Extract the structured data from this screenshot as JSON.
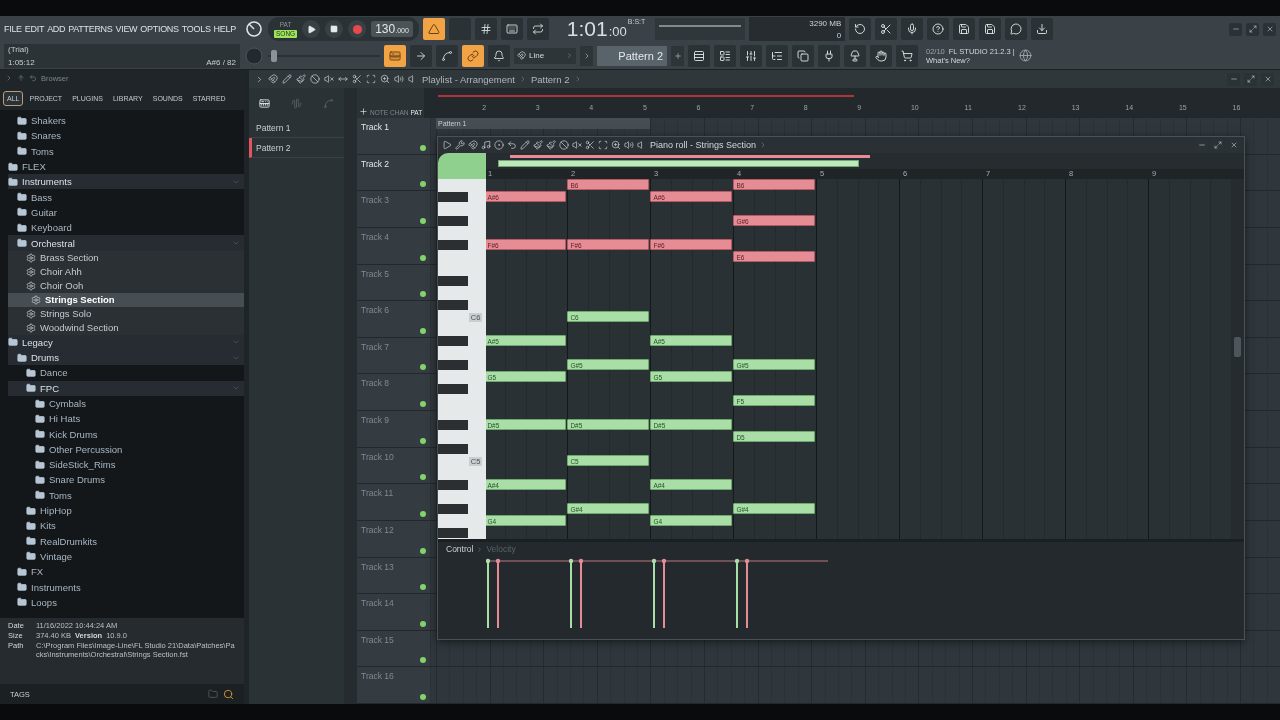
{
  "menu": [
    "FILE",
    "EDIT",
    "ADD",
    "PATTERNS",
    "VIEW",
    "OPTIONS",
    "TOOLS",
    "HELP"
  ],
  "hint": {
    "title": "(Trial)",
    "time": "1:05:12",
    "note": "A#6 / 82"
  },
  "transport": {
    "modes": [
      {
        "label": "PAT",
        "selected": false
      },
      {
        "label": "SONG",
        "selected": true
      }
    ],
    "tempo_whole": "130",
    "tempo_fraction": ".000"
  },
  "top_toggles": [
    {
      "on": true
    },
    {
      "on": false
    },
    {
      "on": false
    },
    {
      "on": false
    },
    {
      "on": false
    }
  ],
  "bottom_toggles": [
    {
      "on": true
    },
    {
      "on": false
    },
    {
      "on": false
    },
    {
      "on": true
    },
    {
      "on": false
    }
  ],
  "clock": {
    "main": "1:01",
    "sub": ":00",
    "unit": "B:S:T"
  },
  "monitor": {
    "voices": "3",
    "memory": "290 MB",
    "cpu": "0"
  },
  "pitch_slider": {
    "level": 0.03
  },
  "snap": {
    "label": "Line"
  },
  "pattern_picker": {
    "label": "Pattern 2"
  },
  "news": {
    "count": "02/10",
    "title": "FL STUDIO 21.2.3 |",
    "link": "What's New?"
  },
  "browser": {
    "title": "Browser",
    "tabs": [
      {
        "label": "ALL",
        "selected": true
      },
      {
        "label": "PROJECT",
        "selected": false
      },
      {
        "label": "PLUGINS",
        "selected": false
      },
      {
        "label": "LIBRARY",
        "selected": false
      },
      {
        "label": "SOUNDS",
        "selected": false
      },
      {
        "label": "STARRED",
        "selected": false
      }
    ],
    "tree": [
      {
        "children": [
          {
            "label": "Shakers",
            "kind": "folder",
            "expanded": false,
            "selected": false
          },
          {
            "label": "Snares",
            "kind": "folder",
            "expanded": false,
            "selected": false
          },
          {
            "label": "Toms",
            "kind": "folder",
            "expanded": false,
            "selected": false
          }
        ]
      },
      {
        "label": "FLEX",
        "kind": "folder",
        "expanded": false,
        "selected": false
      },
      {
        "label": "Instruments",
        "kind": "folder",
        "expanded": true,
        "selected": false,
        "children": [
          {
            "label": "Bass",
            "kind": "folder",
            "expanded": false,
            "selected": false
          },
          {
            "label": "Guitar",
            "kind": "folder",
            "expanded": false,
            "selected": false
          },
          {
            "label": "Keyboard",
            "kind": "folder",
            "expanded": false,
            "selected": false
          },
          {
            "label": "Orchestral",
            "kind": "folder",
            "expanded": true,
            "selected": false,
            "children": [
              {
                "label": "Brass Section",
                "kind": "preset",
                "expanded": false,
                "selected": false
              },
              {
                "label": "Choir Ahh",
                "kind": "preset",
                "expanded": false,
                "selected": false
              },
              {
                "label": "Choir Ooh",
                "kind": "preset",
                "expanded": false,
                "selected": false
              },
              {
                "label": "Strings Section",
                "kind": "preset",
                "expanded": false,
                "selected": true
              },
              {
                "label": "Strings Solo",
                "kind": "preset",
                "expanded": false,
                "selected": false
              },
              {
                "label": "Woodwind Section",
                "kind": "preset",
                "expanded": false,
                "selected": false
              }
            ]
          }
        ]
      },
      {
        "label": "Legacy",
        "kind": "folder",
        "expanded": true,
        "selected": false,
        "children": [
          {
            "label": "Drums",
            "kind": "folder",
            "expanded": true,
            "selected": false,
            "children": [
              {
                "label": "Dance",
                "kind": "folder",
                "expanded": false,
                "selected": false
              },
              {
                "label": "FPC",
                "kind": "folder",
                "expanded": true,
                "selected": false,
                "children": [
                  {
                    "label": "Cymbals",
                    "kind": "folder",
                    "expanded": false,
                    "selected": false
                  },
                  {
                    "label": "Hi Hats",
                    "kind": "folder",
                    "expanded": false,
                    "selected": false
                  },
                  {
                    "label": "Kick Drums",
                    "kind": "folder",
                    "expanded": false,
                    "selected": false
                  },
                  {
                    "label": "Other Percussion",
                    "kind": "folder",
                    "expanded": false,
                    "selected": false
                  },
                  {
                    "label": "SideStick_Rims",
                    "kind": "folder",
                    "expanded": false,
                    "selected": false
                  },
                  {
                    "label": "Snare Drums",
                    "kind": "folder",
                    "expanded": false,
                    "selected": false
                  },
                  {
                    "label": "Toms",
                    "kind": "folder",
                    "expanded": false,
                    "selected": false
                  }
                ]
              },
              {
                "label": "HipHop",
                "kind": "folder",
                "expanded": false,
                "selected": false
              },
              {
                "label": "Kits",
                "kind": "folder",
                "expanded": false,
                "selected": false
              },
              {
                "label": "RealDrumkits",
                "kind": "folder",
                "expanded": false,
                "selected": false
              },
              {
                "label": "Vintage",
                "kind": "folder",
                "expanded": false,
                "selected": false
              }
            ]
          },
          {
            "label": "FX",
            "kind": "folder",
            "expanded": false,
            "selected": false
          },
          {
            "label": "Instruments",
            "kind": "folder",
            "expanded": false,
            "selected": false
          },
          {
            "label": "Loops",
            "kind": "folder",
            "expanded": false,
            "selected": false
          }
        ]
      }
    ],
    "info": {
      "date_label": "Date",
      "date": "11/16/2022 10:44:24 AM",
      "size_label": "Size",
      "size": "374.40 KB",
      "version_label": "Version",
      "version": "10.9.0",
      "path_label": "Path",
      "path": "C:\\Program Files\\Image-Line\\FL Studio 21\\Data\\Patches\\Packs\\Instruments\\Orchestral\\Strings Section.fst"
    },
    "tags_label": "TAGS"
  },
  "playlist": {
    "title": "Playlist - Arrangement",
    "crumb": "Pattern 2",
    "patterns": [
      {
        "label": "Pattern 1",
        "selected": false
      },
      {
        "label": "Pattern 2",
        "selected": true
      }
    ],
    "filters": [
      {
        "label": "NOTE",
        "selected": false
      },
      {
        "label": "CHAN",
        "selected": false
      },
      {
        "label": "PAT",
        "selected": true
      }
    ],
    "ruler": [
      "2",
      "3",
      "4",
      "5",
      "6",
      "7",
      "8",
      "9",
      "10",
      "11",
      "12",
      "13",
      "14",
      "15",
      "16"
    ],
    "tracks": [
      {
        "label": "Track 1",
        "active": true,
        "clip": "Pattern 1"
      },
      {
        "label": "Track 2",
        "active": true
      },
      {
        "label": "Track 3",
        "active": false
      },
      {
        "label": "Track 4",
        "active": false
      },
      {
        "label": "Track 5",
        "active": false
      },
      {
        "label": "Track 6",
        "active": false
      },
      {
        "label": "Track 7",
        "active": false
      },
      {
        "label": "Track 8",
        "active": false
      },
      {
        "label": "Track 9",
        "active": false
      },
      {
        "label": "Track 10",
        "active": false
      },
      {
        "label": "Track 11",
        "active": false
      },
      {
        "label": "Track 12",
        "active": false
      },
      {
        "label": "Track 13",
        "active": false
      },
      {
        "label": "Track 14",
        "active": false
      },
      {
        "label": "Track 15",
        "active": false
      },
      {
        "label": "Track 16",
        "active": false
      }
    ]
  },
  "piano_roll": {
    "title": "Piano roll - Strings Section",
    "ruler": [
      "1",
      "2",
      "3",
      "4",
      "5",
      "6",
      "7",
      "8",
      "9"
    ],
    "lanes": [
      {
        "cells": [
          null,
          {
            "label": "B6",
            "selected": true
          },
          null,
          {
            "label": "B6",
            "selected": true
          }
        ]
      },
      {
        "cells": [
          {
            "label": "A#6",
            "selected": true
          },
          null,
          {
            "label": "A#6",
            "selected": true
          },
          null
        ]
      },
      {
        "cells": [
          null,
          null,
          null,
          null
        ]
      },
      {
        "cells": [
          null,
          null,
          null,
          {
            "label": "G#6",
            "selected": true
          }
        ]
      },
      {
        "cells": [
          null,
          null,
          null,
          null
        ]
      },
      {
        "cells": [
          {
            "label": "F#6",
            "selected": true
          },
          {
            "label": "F#6",
            "selected": true
          },
          {
            "label": "F#6",
            "selected": true
          },
          null
        ]
      },
      {
        "cells": [
          null,
          null,
          null,
          {
            "label": "E6",
            "selected": true
          }
        ]
      },
      {
        "cells": [
          null,
          null,
          null,
          null
        ]
      },
      {
        "cells": [
          null,
          null,
          null,
          null
        ]
      },
      {
        "cells": [
          null,
          null,
          null,
          null
        ]
      },
      {
        "cells": [
          null,
          null,
          null,
          null
        ]
      },
      {
        "key_label": "C6",
        "cells": [
          null,
          {
            "label": "C6",
            "selected": false
          },
          null,
          null
        ]
      },
      {
        "cells": [
          null,
          null,
          null,
          null
        ]
      },
      {
        "cells": [
          {
            "label": "A#5",
            "selected": false
          },
          null,
          {
            "label": "A#5",
            "selected": false
          },
          null
        ]
      },
      {
        "cells": [
          null,
          null,
          null,
          null
        ]
      },
      {
        "cells": [
          null,
          {
            "label": "G#5",
            "selected": false
          },
          null,
          {
            "label": "G#5",
            "selected": false
          }
        ]
      },
      {
        "cells": [
          {
            "label": "G5",
            "selected": false
          },
          null,
          {
            "label": "G5",
            "selected": false
          },
          null
        ]
      },
      {
        "cells": [
          null,
          null,
          null,
          null
        ]
      },
      {
        "cells": [
          null,
          null,
          null,
          {
            "label": "F5",
            "selected": false
          }
        ]
      },
      {
        "cells": [
          null,
          null,
          null,
          null
        ]
      },
      {
        "cells": [
          {
            "label": "D#5",
            "selected": false
          },
          {
            "label": "D#5",
            "selected": false
          },
          {
            "label": "D#5",
            "selected": false
          },
          null
        ]
      },
      {
        "cells": [
          null,
          null,
          null,
          {
            "label": "D5",
            "selected": false
          }
        ]
      },
      {
        "cells": [
          null,
          null,
          null,
          null
        ]
      },
      {
        "key_label": "C5",
        "cells": [
          null,
          {
            "label": "C5",
            "selected": false
          },
          null,
          null
        ]
      },
      {
        "cells": [
          null,
          null,
          null,
          null
        ]
      },
      {
        "cells": [
          {
            "label": "A#4",
            "selected": false
          },
          null,
          {
            "label": "A#4",
            "selected": false
          },
          null
        ]
      },
      {
        "cells": [
          null,
          null,
          null,
          null
        ]
      },
      {
        "cells": [
          null,
          {
            "label": "G#4",
            "selected": false
          },
          null,
          {
            "label": "G#4",
            "selected": false
          }
        ]
      },
      {
        "cells": [
          {
            "label": "G4",
            "selected": false
          },
          null,
          {
            "label": "G4",
            "selected": false
          },
          null
        ]
      },
      {
        "cells": [
          null,
          null,
          null,
          null
        ]
      }
    ],
    "control": {
      "label": "Control",
      "target": "Velocity"
    }
  }
}
